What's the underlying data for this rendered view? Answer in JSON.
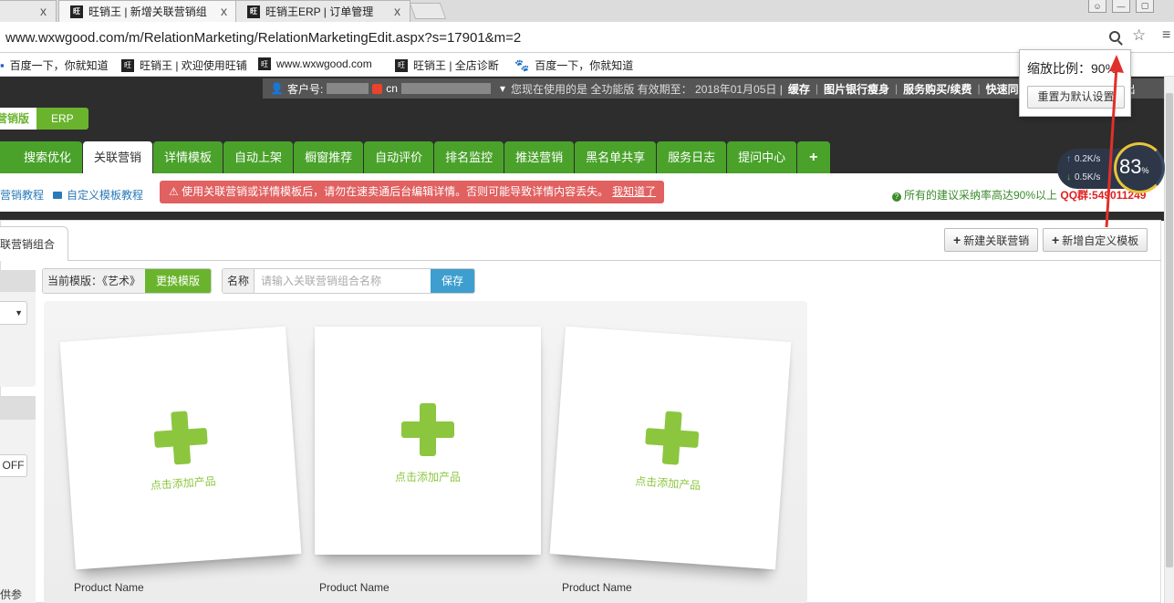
{
  "browser": {
    "tabs": [
      {
        "title": "",
        "close": "x"
      },
      {
        "title": "旺销王 | 新增关联营销组",
        "close": "x"
      },
      {
        "title": "旺销王ERP | 订单管理",
        "close": "x"
      }
    ],
    "url": "www.wxwgood.com/m/RelationMarketing/RelationMarketingEdit.aspx?s=17901&m=2",
    "bookmarks": [
      "百度一下，你就知道",
      "旺销王 | 欢迎使用旺铺",
      "www.wxwgood.com",
      "旺销王 | 全店诊断",
      "百度一下，你就知道"
    ],
    "favicon_text": "旺",
    "zoom_popup": {
      "label": "缩放比例：90%",
      "reset": "重置为默认设置"
    }
  },
  "header": {
    "customer_label": "客户号:",
    "account_prefix": "cn",
    "version_info": "您现在使用的是 全功能版 有效期至： 2018年01月05日 |",
    "links": [
      "缓存",
      "图片银行瘦身",
      "服务购买/续费",
      "快速同"
    ],
    "exit_tail": "出",
    "version_switch": [
      "营销版",
      "ERP"
    ]
  },
  "nav": {
    "tabs": [
      "搜索优化",
      "关联营销",
      "详情模板",
      "自动上架",
      "橱窗推荐",
      "自动评价",
      "排名监控",
      "推送营销",
      "黑名单共享",
      "服务日志",
      "提问中心"
    ],
    "active_index": 1,
    "plus": "+"
  },
  "notice": {
    "tutorial1": "营销教程",
    "tutorial2": "自定义模板教程",
    "warning": "⚠ 使用关联营销或详情模板后，请勿在速卖通后台编辑详情。否则可能导致详情内容丢失。",
    "warning_link": "我知道了",
    "tip": "所有的建议采纳率高达90%以上",
    "qq": "QQ群:549011249"
  },
  "main": {
    "subtab": "关联营销组合",
    "btn_new_relation": "新建关联营销",
    "btn_new_template": "新增自定义模板",
    "current_template": "当前模版：《艺术》",
    "change_template": "更换模版",
    "name_label": "名称",
    "name_placeholder": "请输入关联营销组合名称",
    "save": "保存",
    "left_off": "OFF",
    "left_bottom": "供参",
    "cards": [
      {
        "add_text": "点击添加产品",
        "product_name": "Product Name"
      },
      {
        "add_text": "点击添加产品",
        "product_name": "Product Name"
      },
      {
        "add_text": "点击添加产品",
        "product_name": "Product Name"
      }
    ]
  },
  "speed_widget": {
    "up": "0.2K/s",
    "down": "0.5K/s",
    "percent": "83",
    "unit": "%"
  },
  "colors": {
    "brand_green": "#4aa22b",
    "warning_red": "#e16060",
    "save_blue": "#3d9ecf",
    "plus_green": "#8cc63f"
  }
}
